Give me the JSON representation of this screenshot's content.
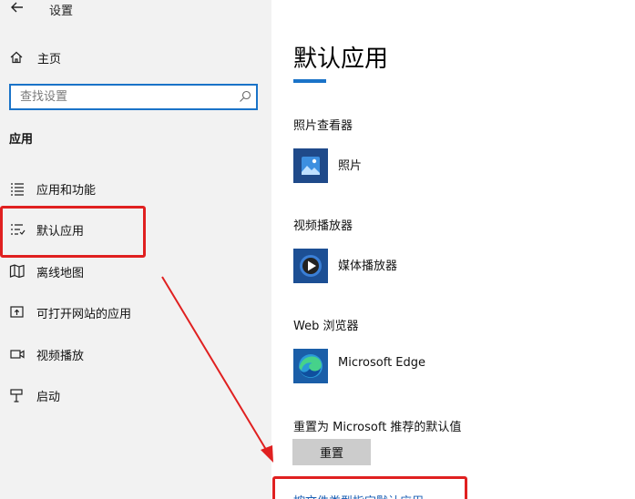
{
  "window": {
    "title": "设置"
  },
  "sidebar": {
    "home_label": "主页",
    "search_placeholder": "查找设置",
    "section_heading": "应用",
    "items": [
      {
        "label": "应用和功能",
        "icon": "apps-features-icon"
      },
      {
        "label": "默认应用",
        "icon": "default-apps-icon"
      },
      {
        "label": "离线地图",
        "icon": "offline-maps-icon"
      },
      {
        "label": "可打开网站的应用",
        "icon": "apps-for-websites-icon"
      },
      {
        "label": "视频播放",
        "icon": "video-playback-icon"
      },
      {
        "label": "启动",
        "icon": "startup-icon"
      }
    ]
  },
  "main": {
    "title": "默认应用",
    "categories": [
      {
        "label": "照片查看器",
        "app": "照片",
        "icon": "photos-app-icon"
      },
      {
        "label": "视频播放器",
        "app": "媒体播放器",
        "icon": "media-player-icon"
      },
      {
        "label": "Web 浏览器",
        "app": "Microsoft Edge",
        "icon": "edge-icon"
      }
    ],
    "reset_label": "重置为 Microsoft 推荐的默认值",
    "reset_button": "重置",
    "link_text": "按文件类型指定默认应用"
  },
  "colors": {
    "accent": "#1a73c8",
    "annotation": "#e02020",
    "link": "#1a5fb4"
  }
}
